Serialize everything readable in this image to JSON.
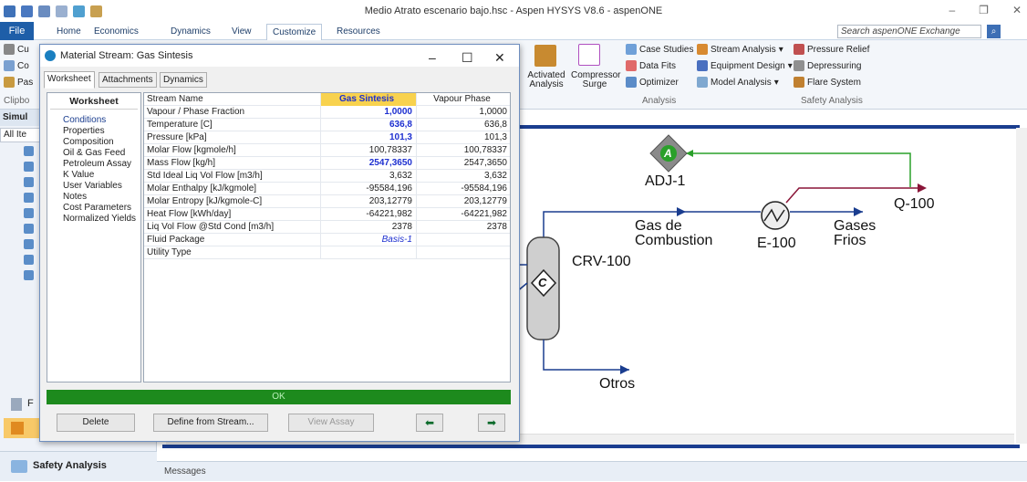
{
  "window": {
    "title": "Medio Atrato escenario bajo.hsc - Aspen HYSYS V8.6 - aspenONE"
  },
  "ribbon": {
    "tabs": [
      "File",
      "Home",
      "Economics",
      "Dynamics",
      "View",
      "Customize",
      "Resources"
    ],
    "search_placeholder": "Search aspenONE Exchange",
    "clipboard_items": [
      "Cu",
      "Co",
      "Pas"
    ],
    "clipboard_label": "Clipbo",
    "activated_analysis": "Activated Analysis",
    "compressor_surge": "Compressor Surge",
    "analysis_items": [
      "Case Studies",
      "Data Fits",
      "Optimizer",
      "Stream Analysis",
      "Equipment Design",
      "Model Analysis"
    ],
    "analysis_label": "Analysis",
    "safety_items": [
      "Pressure Relief",
      "Depressuring",
      "Flare System"
    ],
    "safety_label": "Safety Analysis"
  },
  "left_panel": {
    "header": "Simul",
    "all_items": "All Ite",
    "safety_analysis": "Safety Analysis",
    "item_letter": "F"
  },
  "dialog": {
    "title": "Material Stream: Gas Sintesis",
    "tabs": [
      "Worksheet",
      "Attachments",
      "Dynamics"
    ],
    "nav_title": "Worksheet",
    "nav_items": [
      "Conditions",
      "Properties",
      "Composition",
      "Oil & Gas Feed",
      "Petroleum Assay",
      "K Value",
      "User Variables",
      "Notes",
      "Cost Parameters",
      "Normalized Yields"
    ],
    "grid": {
      "header": [
        "Stream Name",
        "Gas Sintesis",
        "Vapour Phase"
      ],
      "rows": [
        [
          "Vapour / Phase Fraction",
          "1,0000",
          "1,0000"
        ],
        [
          "Temperature [C]",
          "636,8",
          "636,8"
        ],
        [
          "Pressure [kPa]",
          "101,3",
          "101,3"
        ],
        [
          "Molar Flow [kgmole/h]",
          "100,78337",
          "100,78337"
        ],
        [
          "Mass Flow [kg/h]",
          "2547,3650",
          "2547,3650"
        ],
        [
          "Std Ideal Liq Vol Flow [m3/h]",
          "3,632",
          "3,632"
        ],
        [
          "Molar Enthalpy [kJ/kgmole]",
          "-95584,196",
          "-95584,196"
        ],
        [
          "Molar Entropy [kJ/kgmole-C]",
          "203,12779",
          "203,12779"
        ],
        [
          "Heat Flow [kWh/day]",
          "-64221,982",
          "-64221,982"
        ],
        [
          "Liq Vol Flow @Std Cond [m3/h]",
          "2378",
          "2378"
        ],
        [
          "Fluid Package",
          "Basis-1",
          ""
        ],
        [
          "Utility Type",
          "",
          ""
        ]
      ]
    },
    "status": "OK",
    "buttons": {
      "delete": "Delete",
      "define": "Define from Stream...",
      "view_assay": "View Assay"
    }
  },
  "pfd": {
    "labels": {
      "adj": "ADJ-1",
      "adj_letter": "A",
      "q100": "Q-100",
      "gas_comb_1": "Gas de",
      "gas_comb_2": "Combustion",
      "e100": "E-100",
      "gases_1": "Gases",
      "gases_2": "Frios",
      "crv": "CRV-100",
      "crv_letter": "C",
      "otros": "Otros"
    },
    "colors": {
      "stream": "#1a3d8f",
      "energy": "#8a1538",
      "signal": "#2aa02a"
    }
  },
  "messages_label": "Messages"
}
